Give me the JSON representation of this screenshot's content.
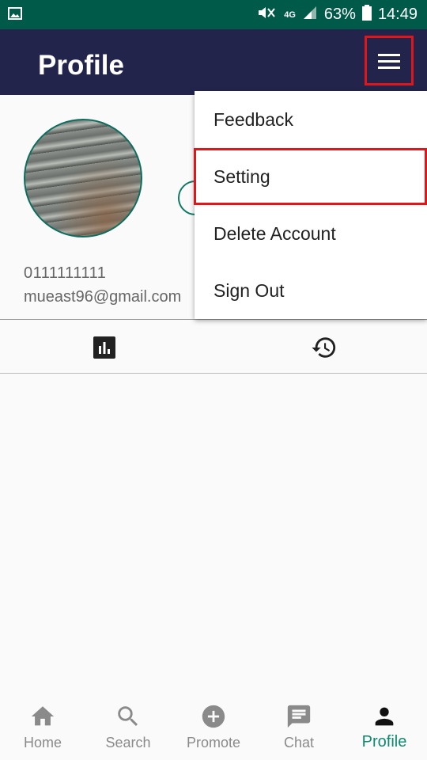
{
  "status_bar": {
    "battery": "63%",
    "time": "14:49",
    "network": "4G"
  },
  "header": {
    "title": "Profile",
    "menu_icon": "hamburger-menu-icon"
  },
  "profile": {
    "phone": "0111111111",
    "email": "mueast96@gmail.com"
  },
  "tabs": [
    {
      "icon": "bar-chart-icon"
    },
    {
      "icon": "history-icon"
    }
  ],
  "menu": {
    "items": [
      {
        "label": "Feedback"
      },
      {
        "label": "Setting"
      },
      {
        "label": "Delete Account"
      },
      {
        "label": "Sign Out"
      }
    ]
  },
  "bottom_nav": {
    "items": [
      {
        "label": "Home",
        "icon": "home-icon"
      },
      {
        "label": "Search",
        "icon": "search-icon"
      },
      {
        "label": "Promote",
        "icon": "add-circle-icon"
      },
      {
        "label": "Chat",
        "icon": "chat-icon"
      },
      {
        "label": "Profile",
        "icon": "person-icon",
        "active": true
      }
    ]
  },
  "colors": {
    "status_bar": "#005a4a",
    "app_bar": "#22244b",
    "accent": "#0e8a6e",
    "highlight": "#e0161b"
  }
}
